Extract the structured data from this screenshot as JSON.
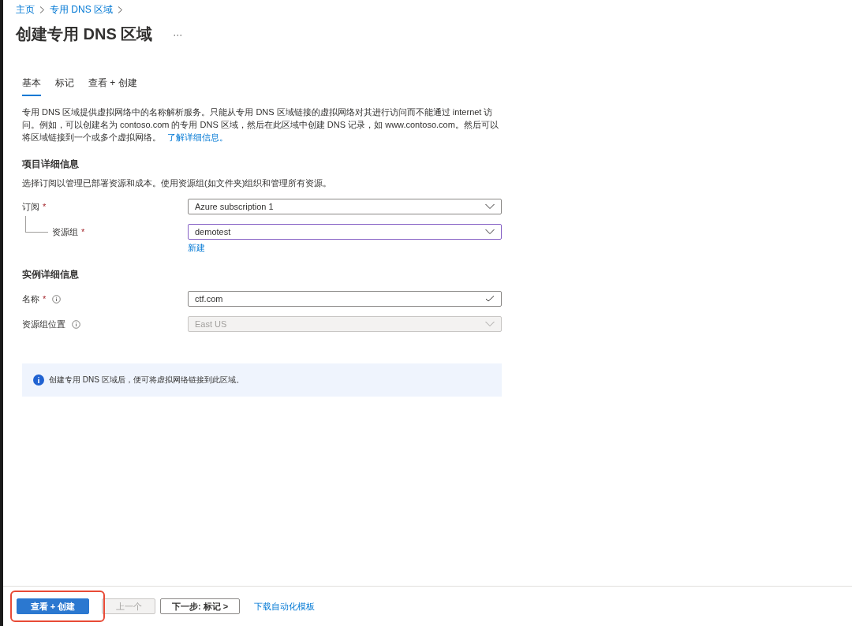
{
  "breadcrumb": [
    "主页",
    "专用 DNS 区域"
  ],
  "title": "创建专用 DNS 区域",
  "more": "···",
  "tabs": [
    {
      "label": "基本",
      "selected": true
    },
    {
      "label": "标记",
      "selected": false
    },
    {
      "label": "查看 + 创建",
      "selected": false
    }
  ],
  "description": {
    "text": "专用 DNS 区域提供虚拟网络中的名称解析服务。只能从专用 DNS 区域链接的虚拟网络对其进行访问而不能通过 internet 访问。例如，可以创建名为 contoso.com 的专用 DNS 区域，然后在此区域中创建 DNS 记录，如 www.contoso.com。然后可以将区域链接到一个或多个虚拟网络。",
    "link": "了解详细信息。"
  },
  "sections": [
    {
      "heading": "项目详细信息",
      "text": "选择订阅以管理已部署资源和成本。使用资源组(如文件夹)组织和管理所有资源。",
      "fields": [
        {
          "label": "订阅",
          "required_mark": "*",
          "info": false,
          "kind": "dropdown",
          "value": "Azure subscription 1",
          "focused": false,
          "disabled": false,
          "children": [
            {
              "label": "资源组",
              "required_mark": "*",
              "info": false,
              "kind": "dropdown",
              "value": "demotest",
              "focused": true,
              "disabled": false,
              "link": "新建"
            }
          ]
        }
      ]
    },
    {
      "heading": "实例详细信息",
      "fields": [
        {
          "label": "名称",
          "required_mark": "*",
          "info": true,
          "kind": "text",
          "value": "ctf.com",
          "focused": false,
          "valid": true,
          "disabled": false
        },
        {
          "label": "资源组位置",
          "info": true,
          "kind": "dropdown",
          "value": "East US",
          "focused": false,
          "disabled": true
        }
      ]
    }
  ],
  "notice": "创建专用 DNS 区域后，便可将虚拟网络链接到此区域。",
  "footer": [
    {
      "kind": "primary",
      "label": "查看 + 创建",
      "disabled": false,
      "highlighted": true
    },
    {
      "kind": "secondary",
      "label": "上一个",
      "disabled": true
    },
    {
      "kind": "secondary",
      "label": "下一步: 标记 >",
      "disabled": false
    },
    {
      "kind": "link",
      "label": "下载自动化模板"
    }
  ]
}
